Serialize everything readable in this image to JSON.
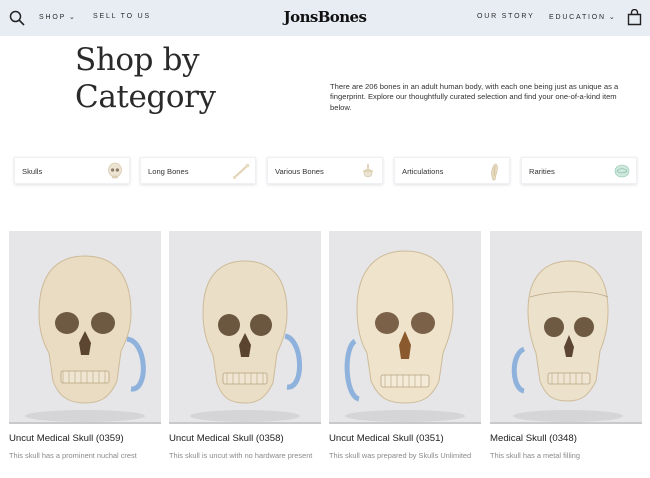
{
  "header": {
    "brand": "JonsBones",
    "nav_left": [
      {
        "label": "SHOP",
        "has_dropdown": true
      },
      {
        "label": "SELL TO US",
        "has_dropdown": false
      }
    ],
    "nav_right": [
      {
        "label": "OUR STORY",
        "has_dropdown": false
      },
      {
        "label": "EDUCATION",
        "has_dropdown": true
      }
    ],
    "icons": {
      "search": "search-icon",
      "bag": "shopping-bag-icon",
      "dropdown": "chevron-down-icon"
    },
    "background": "#e8edf4"
  },
  "hero": {
    "title": "Shop by Category",
    "description": "There are 206 bones in an adult human body, with each one being just as unique as a fingerprint. Explore our thoughtfully curated selection and find your one-of-a-kind item below."
  },
  "categories": [
    {
      "label": "Skulls",
      "icon": "skull-icon"
    },
    {
      "label": "Long Bones",
      "icon": "long-bone-icon"
    },
    {
      "label": "Various Bones",
      "icon": "vertebra-icon"
    },
    {
      "label": "Articulations",
      "icon": "hand-articulation-icon"
    },
    {
      "label": "Rarities",
      "icon": "rarity-icon"
    }
  ],
  "products": [
    {
      "name": "Uncut Medical Skull (0359)",
      "description": "This skull has a prominent nuchal crest"
    },
    {
      "name": "Uncut Medical Skull (0358)",
      "description": "This skull is uncut with no hardware present"
    },
    {
      "name": "Uncut Medical Skull (0351)",
      "description": "This skull was prepared by Skulls Unlimited"
    },
    {
      "name": "Medical Skull (0348)",
      "description": "This skull has a metal filling"
    }
  ],
  "colors": {
    "bone": "#e8dcc4",
    "spring": "#8fb2dc",
    "product_bg": "#e6e6e8"
  }
}
